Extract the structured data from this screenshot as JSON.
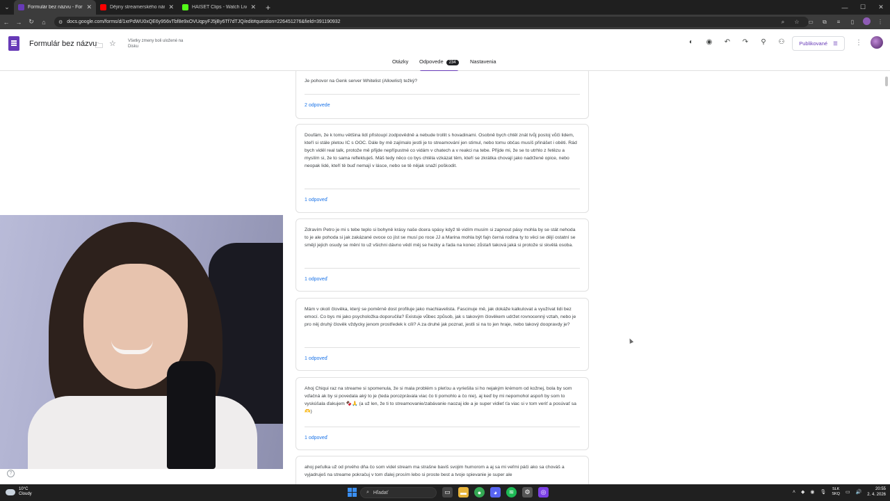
{
  "browser": {
    "tabs": [
      {
        "title": "Formulár bez názvu - Formulár",
        "color": "#673ab7",
        "active": true
      },
      {
        "title": "Dějiny streamerského národa",
        "color": "#ff0000",
        "active": false
      },
      {
        "title": "HAISET Clips - Watch Live on K",
        "color": "#53fc18",
        "active": false
      }
    ],
    "new_tab": "+",
    "url": "docs.google.com/forms/d/1xrPdWU0xQE6y956vTbf8e9xOVUqpyFJ5jBy6Tf7dTJQ/edit#question=226451276&field=391190932"
  },
  "form_header": {
    "title": "Formulár bez názvu",
    "saved_note": "Všetky zmeny boli uložené na Disku",
    "publish_label": "Publikované",
    "tabs": [
      {
        "label": "Otázky"
      },
      {
        "label": "Odpovede",
        "badge": "234"
      },
      {
        "label": "Nastavenia"
      }
    ]
  },
  "responses": [
    {
      "text": "Je pohovor na Genk server Whitelist (Allowlist) težký?",
      "count": "2 odpovede"
    },
    {
      "text": "Doufám, že k tomu většina lidí přistoupí zodpovědně a nebude trollit s hovadinami. Osobně bych chtěl znát tvůj postoj vůči lidem, kteří si stále pletou IC s OOC. Dále by mě zajímalo jestli je to streamování jen stimul, nebo tomu občas musíš přinášet i oběti. Rád bych viděl real talk, protože mě přijde nepřípustné co vidám v chatech a v reakci na tebe. Přijde mi, že se to utrhlo z řetězu a myslím si, že to sama reflektuješ. Máš tedy něco co bys chtěla vzkázat těm, kteří se zkrátka chovají jako nadržené opice, nebo neopak lidé, kteří tě buď nemají v lásce, nebo se tě nějak snaží poškodit.",
      "count": "1 odpoveď"
    },
    {
      "text": "Zdravím Petro je mi s tebe teplo si bohyně krásy naše dcera spásy když tě vidím musím si zapnout pásy mohla by se stát nehoda to je ale pohoda si jak zakázané ovoce co jíst se musí po roce JJ a Marina mohla být fajn černá rodina ty to věci se dějí ostatní se smějí jejich osudy se mění to už všichni dávno vědí měj se hezky a řada na konec zůstaň taková jaká si protože si skvělá osoba.",
      "count": "1 odpoveď"
    },
    {
      "text": "Mám v okolí člověka, který se poměrně dost profiluje jako machiavelista. Fascinuje mě, jak dokáže kalkulovat a využívat lidi bez emocí. Co bys mi jako psycholožka doporučila? Existuje vůbec způsob, jak s takovým člověkem udržet rovnocenný vztah, nebo je pro něj druhý člověk vždycky jenom prostředek k cíli? A za druhé jak poznat, jestli si na to jen hraje, nebo takový doopravdy je?",
      "count": "1 odpoveď"
    },
    {
      "text": "Ahoj Chiqui raz na streame si spomenula, že si mala problém s pleťou a vyriešila si ho nejakým krémom od kožnej, bola by som vďačná ak by si povedala aký to je (teda porozprávala viac čo ti pomohlo a čo nie), aj keď by mi nepomohol aspoň by som to vyskúšala ďakujem 🍫🙏 (a už len, že ti to streamovanie/zabávanie naozaj ide a je super vidieť ťa viac si v tom veriť a posúvať sa🫶)",
      "count": "1 odpoveď"
    },
    {
      "text": "ahoj peťulka už od prvého dňa čo som videl stream ma strašne baviš svojim humorom a aj sa mi veľmi páči ako sa chováš a vyjadruješ na streame pokračuj v tom ďalej prosím lebo si proste best a tvoje spievanie je super ale",
      "count": ""
    }
  ],
  "taskbar": {
    "weather_temp": "10°C",
    "weather_desc": "Cloudy",
    "search_placeholder": "Hľadať",
    "lang_top": "SLK",
    "lang_bottom": "SKQ",
    "time": "20:55",
    "date": "2. 4. 2026"
  }
}
